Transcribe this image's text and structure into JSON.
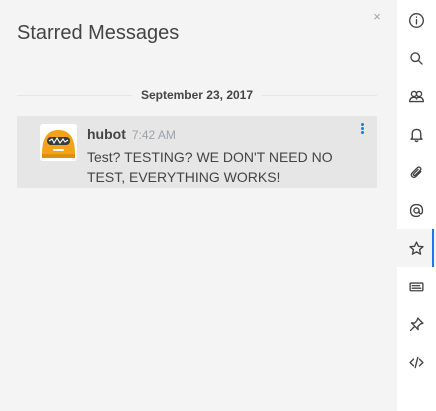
{
  "panel": {
    "title": "Starred Messages",
    "close_glyph": "×"
  },
  "day_divider": {
    "label": "September 23, 2017"
  },
  "message": {
    "username": "hubot",
    "time": "7:42 AM",
    "text": "Test? TESTING? WE DON'T NEED NO TEST, EVERYTHING WORKS!",
    "avatar": "hubot-avatar"
  },
  "toolbar": {
    "active": "starred-icon",
    "icons": [
      "info-icon",
      "search-icon",
      "members-icon",
      "notifications-icon",
      "files-icon",
      "mentions-icon",
      "starred-icon",
      "keyboard-icon",
      "pinned-icon",
      "code-icon"
    ]
  },
  "colors": {
    "accent": "#1d74f5",
    "avatar_orange": "#f4a21c",
    "background": "#f4f4f4",
    "message_highlight": "#e6e6e6"
  }
}
